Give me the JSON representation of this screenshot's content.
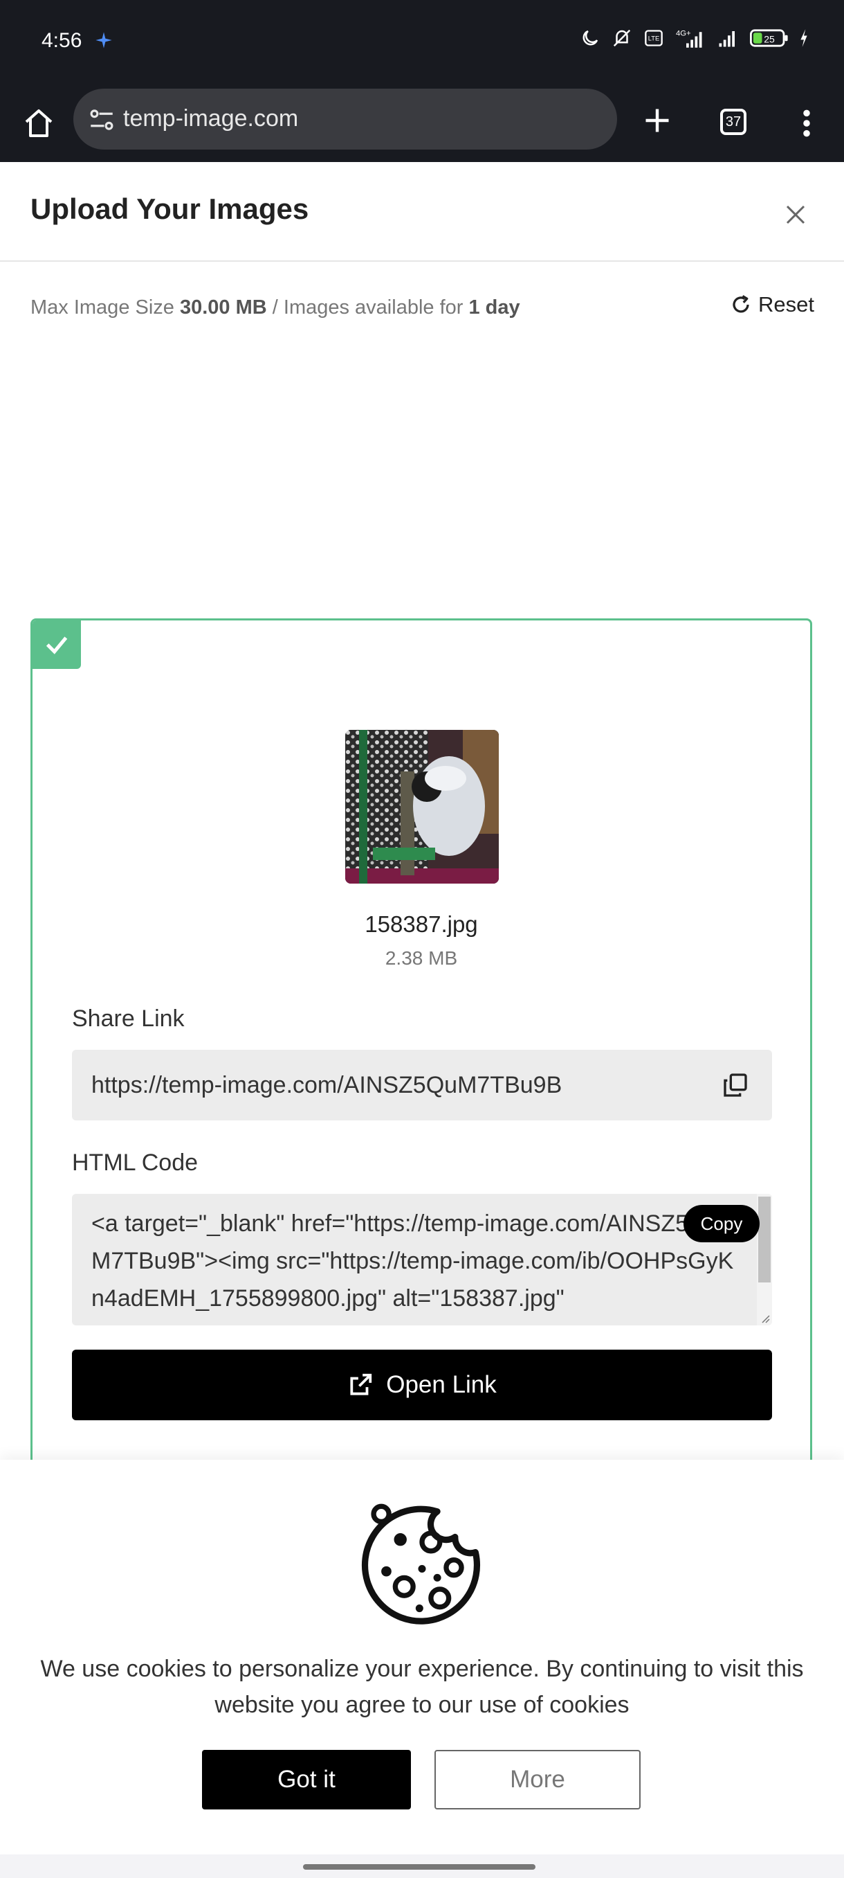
{
  "status_bar": {
    "time": "4:56",
    "battery": "25"
  },
  "browser": {
    "url": "temp-image.com",
    "tab_count": "37"
  },
  "modal": {
    "title": "Upload Your Images",
    "info": {
      "prefix": "Max Image Size ",
      "max_size": "30.00 MB",
      "middle": " / Images available for ",
      "availability": "1 day"
    },
    "reset_label": "Reset"
  },
  "upload": {
    "file_name": "158387.jpg",
    "file_size": "2.38 MB",
    "share_label": "Share Link",
    "share_url": "https://temp-image.com/AINSZ5QuM7TBu9B",
    "html_label": "HTML Code",
    "html_code": "<a target=\"_blank\" href=\"https://temp-image.com/AINSZ5QuM7TBu9B\"><img  src=\"https://temp-image.com/ib/OOHPsGyKn4adEMH_1755899800.jpg\" alt=\"158387.jpg\"",
    "copy_label": "Copy",
    "open_link_label": "Open Link"
  },
  "cookie": {
    "text": "We use cookies to personalize your experience. By continuing to visit this website you agree to our use of cookies",
    "accept_label": "Got it",
    "more_label": "More"
  },
  "colors": {
    "accent_green": "#5cc08c",
    "statusbar_bg": "#181a20"
  }
}
